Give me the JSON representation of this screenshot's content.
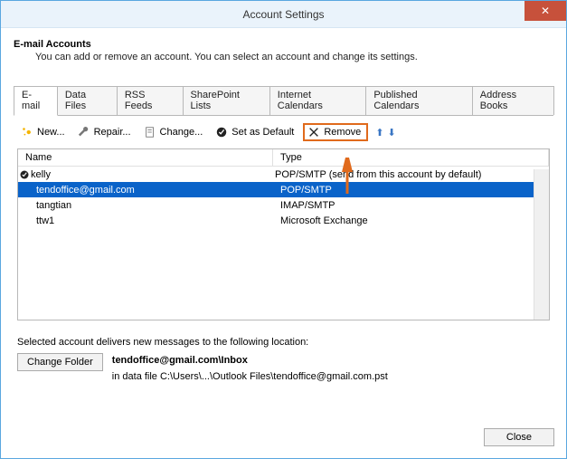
{
  "window": {
    "title": "Account Settings"
  },
  "header": {
    "heading": "E-mail Accounts",
    "sub": "You can add or remove an account. You can select an account and change its settings."
  },
  "tabs": [
    {
      "label": "E-mail",
      "active": true
    },
    {
      "label": "Data Files"
    },
    {
      "label": "RSS Feeds"
    },
    {
      "label": "SharePoint Lists"
    },
    {
      "label": "Internet Calendars"
    },
    {
      "label": "Published Calendars"
    },
    {
      "label": "Address Books"
    }
  ],
  "toolbar": {
    "new": "New...",
    "repair": "Repair...",
    "change": "Change...",
    "default": "Set as Default",
    "remove": "Remove"
  },
  "columns": {
    "name": "Name",
    "type": "Type"
  },
  "accounts": [
    {
      "name": "kelly",
      "type": "POP/SMTP (send from this account by default)",
      "default": true,
      "selected": false
    },
    {
      "name": "tendoffice@gmail.com",
      "type": "POP/SMTP",
      "default": false,
      "selected": true
    },
    {
      "name": "tangtian",
      "type": "IMAP/SMTP",
      "default": false,
      "selected": false
    },
    {
      "name": "ttw1",
      "type": "Microsoft Exchange",
      "default": false,
      "selected": false
    }
  ],
  "delivery": {
    "intro": "Selected account delivers new messages to the following location:",
    "changeFolder": "Change Folder",
    "locationBold": "tendoffice@gmail.com\\Inbox",
    "locationDetail": "in data file C:\\Users\\...\\Outlook Files\\tendoffice@gmail.com.pst"
  },
  "footer": {
    "close": "Close"
  }
}
